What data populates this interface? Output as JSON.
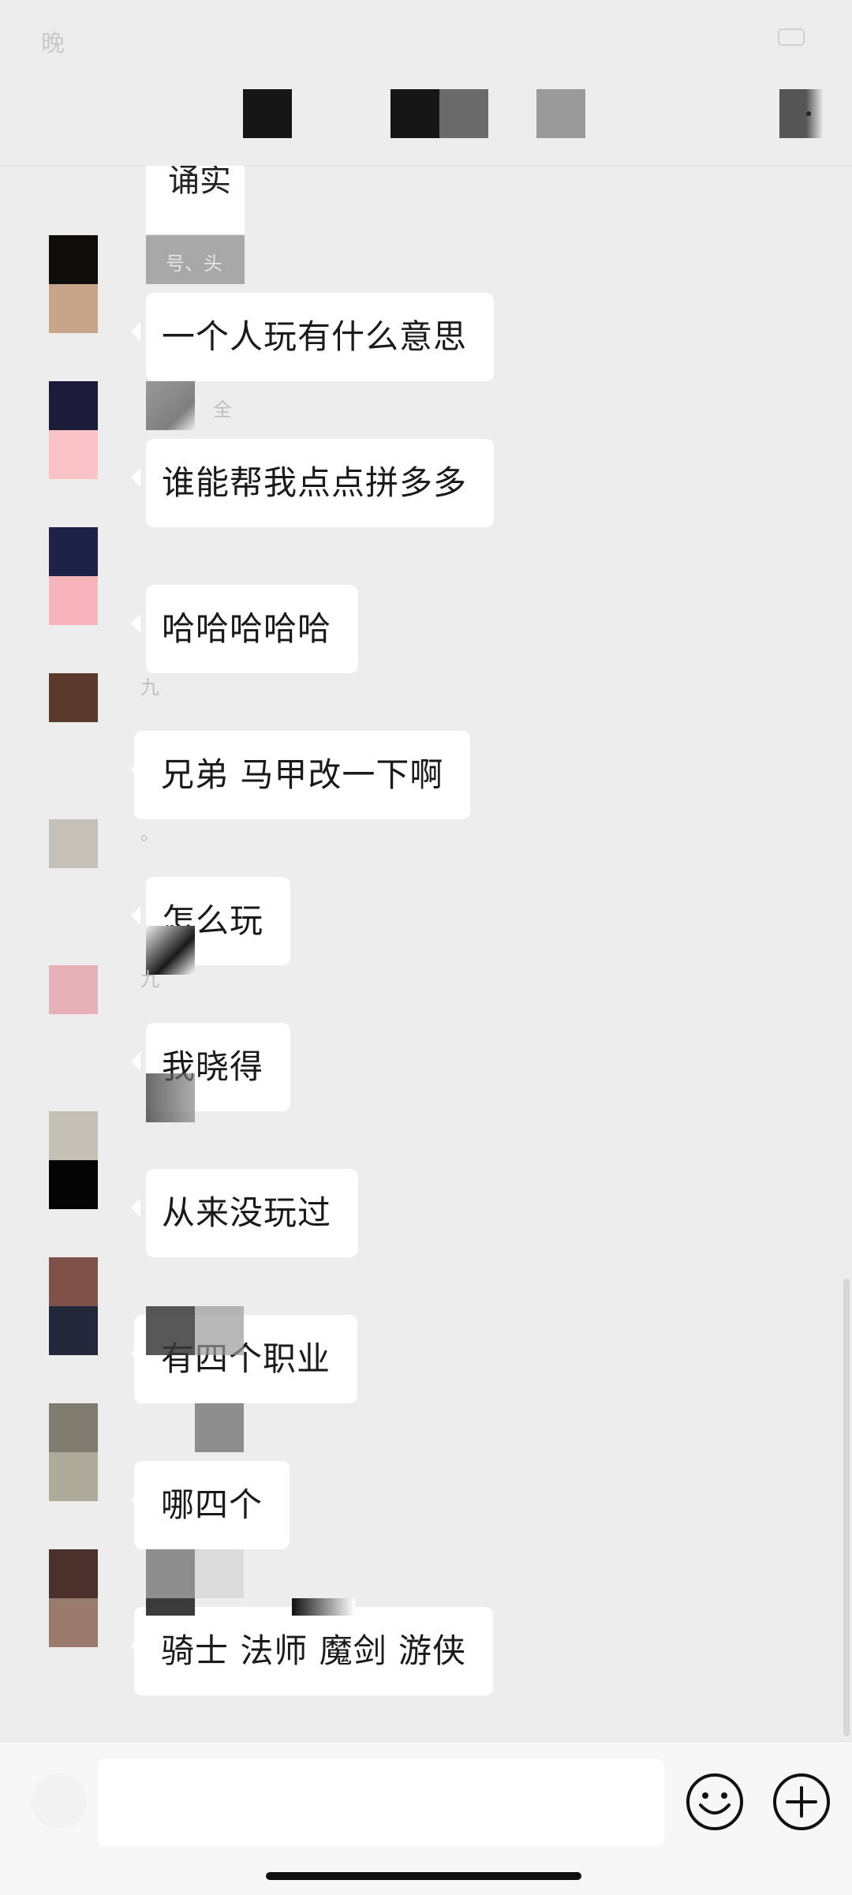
{
  "status_bar": {
    "time": "晚"
  },
  "chat": {
    "top_partial_text": "诵实",
    "messages": [
      {
        "sender": "号、头",
        "text": "一个人玩有什么意思",
        "avatar_colors": [
          "#0e0d0c",
          "#c8a48a"
        ]
      },
      {
        "sender": "全",
        "text": "谁能帮我点点拼多多",
        "avatar_colors": [
          "#1d1b3a",
          "#fcc3c6"
        ]
      },
      {
        "sender": "",
        "text": "哈哈哈哈哈",
        "avatar_colors": [
          "#1e2148",
          "#f8b4bb"
        ]
      },
      {
        "sender": "九",
        "text": "兄弟 马甲改一下啊",
        "avatar_colors": [
          "#5a3a2a",
          "#ededed"
        ]
      },
      {
        "sender": "。",
        "text": "怎么玩",
        "avatar_colors": [
          "#c4c1b8",
          "#ededed"
        ]
      },
      {
        "sender": "九",
        "text": "我晓得",
        "avatar_colors": [
          "#e7b1ba",
          "#ededed"
        ]
      },
      {
        "sender": "",
        "text": "从来没玩过",
        "avatar_colors": [
          "#c4c0b6",
          "#040404"
        ]
      },
      {
        "sender": "",
        "text": "有四个职业",
        "avatar_colors": [
          "#7f5148",
          "#22273a"
        ]
      },
      {
        "sender": "",
        "text": "哪四个",
        "avatar_colors": [
          "#7e7c6e",
          "#adac9b"
        ]
      },
      {
        "sender": "",
        "text": "骑士  法师  魔剑  游侠",
        "avatar_colors": [
          "#4b302c",
          "#9a7a6c"
        ]
      }
    ]
  },
  "input_bar": {
    "value": "",
    "placeholder": ""
  },
  "icons": {
    "emoji": "smiley-face-icon",
    "more": "plus-circle-icon",
    "title_more": "more-icon"
  }
}
